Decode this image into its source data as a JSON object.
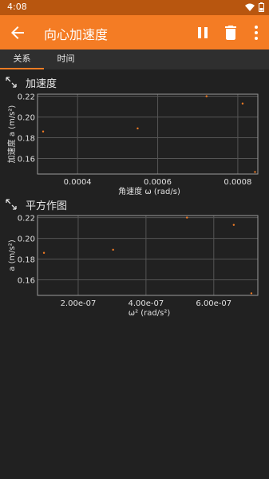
{
  "status": {
    "time": "4:08"
  },
  "app_bar": {
    "title": "向心加速度"
  },
  "tabs": [
    {
      "label": "关系"
    },
    {
      "label": "时间"
    }
  ],
  "sections": [
    {
      "title": "加速度"
    },
    {
      "title": "平方作图"
    }
  ],
  "colors": {
    "accent": "#f47c24",
    "status_bar": "#b8560f",
    "background": "#212121",
    "point": "#f47c24"
  },
  "chart_data": [
    {
      "type": "scatter",
      "title": "加速度",
      "xlabel": "角速度 ω (rad/s)",
      "ylabel": "加速度 a (m/s²)",
      "xlim": [
        0.0003,
        0.00085
      ],
      "ylim": [
        0.145,
        0.222
      ],
      "x_ticks": [
        0.0004,
        0.0006,
        0.0008
      ],
      "x_tick_labels": [
        "0.0004",
        "0.0006",
        "0.0008"
      ],
      "y_ticks": [
        0.16,
        0.18,
        0.2,
        0.22
      ],
      "y_tick_labels": [
        "0.16",
        "0.18",
        "0.20",
        "0.22"
      ],
      "grid": true,
      "points": [
        {
          "x": 0.000314,
          "y": 0.186
        },
        {
          "x": 0.00055,
          "y": 0.189
        },
        {
          "x": 0.000722,
          "y": 0.22
        },
        {
          "x": 0.000812,
          "y": 0.213
        },
        {
          "x": 0.000843,
          "y": 0.147
        }
      ]
    },
    {
      "type": "scatter",
      "title": "平方作图",
      "xlabel": "ω² (rad/s²)",
      "ylabel": "a (m/s²)",
      "xlim": [
        8e-08,
        7.3e-07
      ],
      "ylim": [
        0.145,
        0.222
      ],
      "x_ticks": [
        2e-07,
        4e-07,
        6e-07
      ],
      "x_tick_labels": [
        "2.00e-07",
        "4.00e-07",
        "6.00e-07"
      ],
      "y_ticks": [
        0.16,
        0.18,
        0.2,
        0.22
      ],
      "y_tick_labels": [
        "0.16",
        "0.18",
        "0.20",
        "0.22"
      ],
      "grid": true,
      "points": [
        {
          "x": 9.9e-08,
          "y": 0.186
        },
        {
          "x": 3.03e-07,
          "y": 0.189
        },
        {
          "x": 5.21e-07,
          "y": 0.22
        },
        {
          "x": 6.59e-07,
          "y": 0.213
        },
        {
          "x": 7.11e-07,
          "y": 0.147
        }
      ]
    }
  ]
}
